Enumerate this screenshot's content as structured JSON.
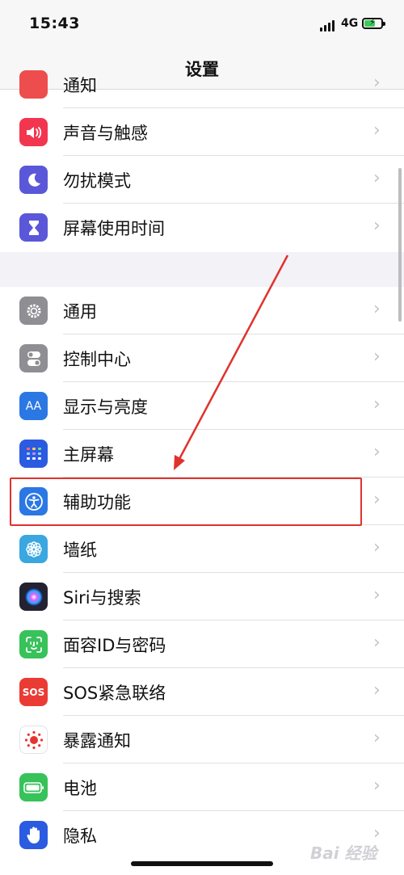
{
  "status_bar": {
    "time": "15:43",
    "network": "4G"
  },
  "nav": {
    "title": "设置"
  },
  "partial_row": {
    "label": "通知",
    "icon": "notifications-icon",
    "color": "#ee4d4d"
  },
  "group1": [
    {
      "label": "声音与触感",
      "icon": "sound-icon",
      "color": "#f2364f"
    },
    {
      "label": "勿扰模式",
      "icon": "moon-icon",
      "color": "#5a58d8"
    },
    {
      "label": "屏幕使用时间",
      "icon": "hourglass-icon",
      "color": "#5a58d8"
    }
  ],
  "group2": [
    {
      "label": "通用",
      "icon": "gear-icon",
      "color": "#8e8e93"
    },
    {
      "label": "控制中心",
      "icon": "toggles-icon",
      "color": "#8e8e93"
    },
    {
      "label": "显示与亮度",
      "icon": "display-icon",
      "glyph": "AA",
      "color": "#2b78e4"
    },
    {
      "label": "主屏幕",
      "icon": "home-screen-icon",
      "color": "#2b5be0"
    },
    {
      "label": "辅助功能",
      "icon": "accessibility-icon",
      "color": "#2b78e4"
    },
    {
      "label": "墙纸",
      "icon": "wallpaper-icon",
      "color": "#3aa7e0"
    },
    {
      "label": "Siri与搜索",
      "icon": "siri-icon",
      "color": "#222230"
    },
    {
      "label": "面容ID与密码",
      "icon": "face-id-icon",
      "color": "#37c25a"
    },
    {
      "label": "SOS紧急联络",
      "icon": "sos-icon",
      "glyph": "SOS",
      "color": "#ea3b34"
    },
    {
      "label": "暴露通知",
      "icon": "exposure-icon",
      "color": "#ffffff"
    },
    {
      "label": "电池",
      "icon": "battery-icon",
      "color": "#37c25a"
    },
    {
      "label": "隐私",
      "icon": "hand-icon",
      "color": "#2b5be0"
    }
  ],
  "chevron": "›",
  "watermark": "Bai 经验",
  "colors": {
    "highlight": "#e0322d",
    "background": "#f2f2f7"
  }
}
